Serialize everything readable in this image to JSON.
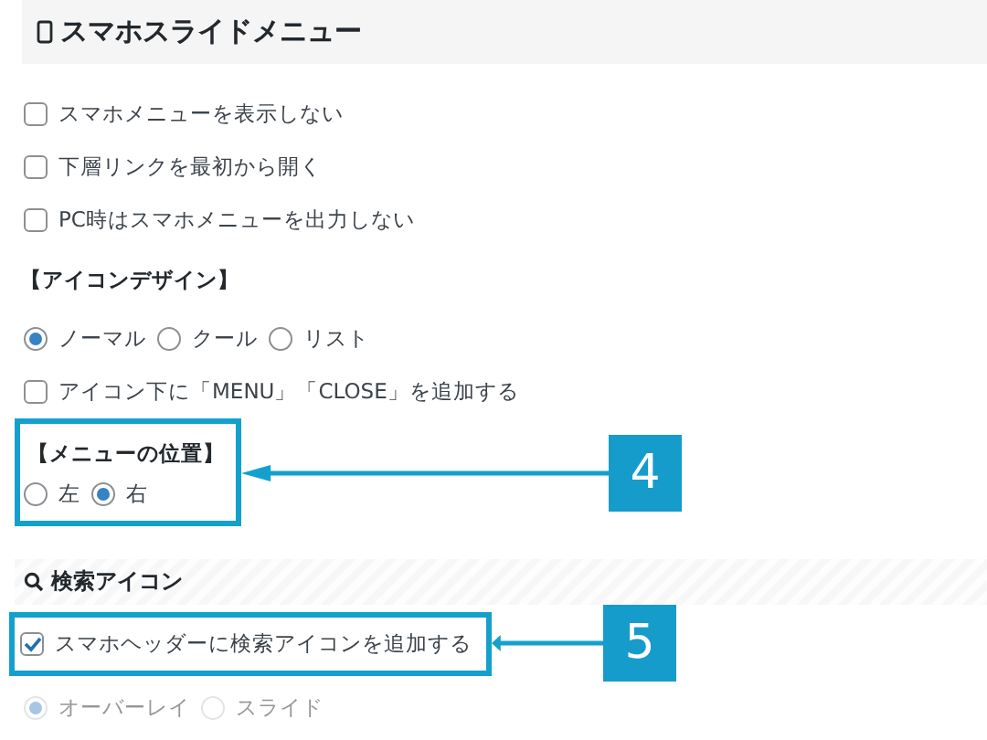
{
  "sections": [
    {
      "title": "スマホスライドメニュー",
      "items": [
        {
          "kind": "checkbox",
          "label": "スマホメニューを表示しない",
          "checked": false
        },
        {
          "kind": "checkbox",
          "label": "下層リンクを最初から開く",
          "checked": false
        },
        {
          "kind": "checkbox",
          "label": "PC時はスマホメニューを出力しない",
          "checked": false
        },
        {
          "kind": "heading",
          "label": "【アイコンデザイン】"
        },
        {
          "kind": "radios",
          "disabled": false,
          "options": [
            {
              "label": "ノーマル",
              "selected": true
            },
            {
              "label": "クール",
              "selected": false
            },
            {
              "label": "リスト",
              "selected": false
            }
          ]
        },
        {
          "kind": "checkbox",
          "label": "アイコン下に「MENU」「CLOSE」を追加する",
          "checked": false
        },
        {
          "kind": "callout",
          "badge": "4",
          "items": [
            {
              "kind": "heading",
              "label": "【メニューの位置】"
            },
            {
              "kind": "radios",
              "disabled": false,
              "options": [
                {
                  "label": "左",
                  "selected": false
                },
                {
                  "label": "右",
                  "selected": true
                }
              ]
            }
          ]
        }
      ]
    },
    {
      "title": "検索アイコン",
      "items": [
        {
          "kind": "callout",
          "badge": "5",
          "items": [
            {
              "kind": "checkbox",
              "label": "スマホヘッダーに検索アイコンを追加する",
              "checked": true
            }
          ]
        },
        {
          "kind": "radios",
          "disabled": true,
          "options": [
            {
              "label": "オーバーレイ",
              "selected": true
            },
            {
              "label": "スライド",
              "selected": false
            }
          ]
        }
      ]
    }
  ]
}
